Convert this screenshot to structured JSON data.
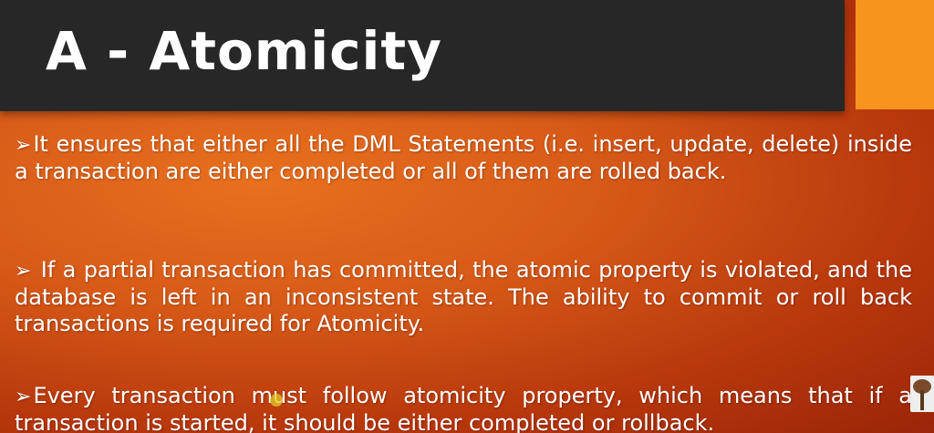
{
  "slide": {
    "title": "A - Atomicity",
    "bullet_marker": "➢",
    "bullets": [
      {
        "text": "It ensures that either all the DML Statements (i.e. insert, update, delete) inside a transaction are either completed or all of them are rolled back."
      },
      {
        "text": " If a partial transaction has committed, the atomic property is violated, and the database is left in an inconsistent state. The ability to commit or roll back transactions is required for Atomicity."
      },
      {
        "text": "Every transaction must follow atomicity property, which means that if a transaction is started, it should be either completed or rollback."
      }
    ]
  },
  "colors": {
    "title_bar": "#272727",
    "accent": "#f7941e",
    "background": "#d85a18",
    "text": "#ffffff"
  },
  "icons": {
    "bullet": "arrow-bullet-icon",
    "corner": "tree-logo-icon"
  }
}
